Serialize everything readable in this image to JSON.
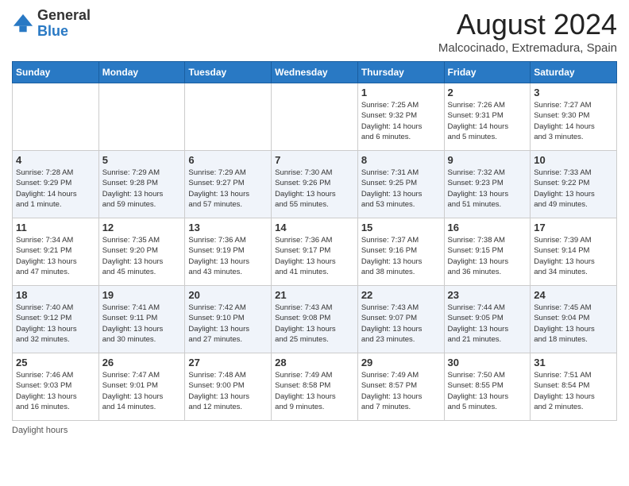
{
  "header": {
    "logo_general": "General",
    "logo_blue": "Blue",
    "month_title": "August 2024",
    "location": "Malcocinado, Extremadura, Spain"
  },
  "days_of_week": [
    "Sunday",
    "Monday",
    "Tuesday",
    "Wednesday",
    "Thursday",
    "Friday",
    "Saturday"
  ],
  "footer": {
    "daylight_note": "Daylight hours"
  },
  "weeks": [
    [
      {
        "day": "",
        "info": ""
      },
      {
        "day": "",
        "info": ""
      },
      {
        "day": "",
        "info": ""
      },
      {
        "day": "",
        "info": ""
      },
      {
        "day": "1",
        "info": "Sunrise: 7:25 AM\nSunset: 9:32 PM\nDaylight: 14 hours\nand 6 minutes."
      },
      {
        "day": "2",
        "info": "Sunrise: 7:26 AM\nSunset: 9:31 PM\nDaylight: 14 hours\nand 5 minutes."
      },
      {
        "day": "3",
        "info": "Sunrise: 7:27 AM\nSunset: 9:30 PM\nDaylight: 14 hours\nand 3 minutes."
      }
    ],
    [
      {
        "day": "4",
        "info": "Sunrise: 7:28 AM\nSunset: 9:29 PM\nDaylight: 14 hours\nand 1 minute."
      },
      {
        "day": "5",
        "info": "Sunrise: 7:29 AM\nSunset: 9:28 PM\nDaylight: 13 hours\nand 59 minutes."
      },
      {
        "day": "6",
        "info": "Sunrise: 7:29 AM\nSunset: 9:27 PM\nDaylight: 13 hours\nand 57 minutes."
      },
      {
        "day": "7",
        "info": "Sunrise: 7:30 AM\nSunset: 9:26 PM\nDaylight: 13 hours\nand 55 minutes."
      },
      {
        "day": "8",
        "info": "Sunrise: 7:31 AM\nSunset: 9:25 PM\nDaylight: 13 hours\nand 53 minutes."
      },
      {
        "day": "9",
        "info": "Sunrise: 7:32 AM\nSunset: 9:23 PM\nDaylight: 13 hours\nand 51 minutes."
      },
      {
        "day": "10",
        "info": "Sunrise: 7:33 AM\nSunset: 9:22 PM\nDaylight: 13 hours\nand 49 minutes."
      }
    ],
    [
      {
        "day": "11",
        "info": "Sunrise: 7:34 AM\nSunset: 9:21 PM\nDaylight: 13 hours\nand 47 minutes."
      },
      {
        "day": "12",
        "info": "Sunrise: 7:35 AM\nSunset: 9:20 PM\nDaylight: 13 hours\nand 45 minutes."
      },
      {
        "day": "13",
        "info": "Sunrise: 7:36 AM\nSunset: 9:19 PM\nDaylight: 13 hours\nand 43 minutes."
      },
      {
        "day": "14",
        "info": "Sunrise: 7:36 AM\nSunset: 9:17 PM\nDaylight: 13 hours\nand 41 minutes."
      },
      {
        "day": "15",
        "info": "Sunrise: 7:37 AM\nSunset: 9:16 PM\nDaylight: 13 hours\nand 38 minutes."
      },
      {
        "day": "16",
        "info": "Sunrise: 7:38 AM\nSunset: 9:15 PM\nDaylight: 13 hours\nand 36 minutes."
      },
      {
        "day": "17",
        "info": "Sunrise: 7:39 AM\nSunset: 9:14 PM\nDaylight: 13 hours\nand 34 minutes."
      }
    ],
    [
      {
        "day": "18",
        "info": "Sunrise: 7:40 AM\nSunset: 9:12 PM\nDaylight: 13 hours\nand 32 minutes."
      },
      {
        "day": "19",
        "info": "Sunrise: 7:41 AM\nSunset: 9:11 PM\nDaylight: 13 hours\nand 30 minutes."
      },
      {
        "day": "20",
        "info": "Sunrise: 7:42 AM\nSunset: 9:10 PM\nDaylight: 13 hours\nand 27 minutes."
      },
      {
        "day": "21",
        "info": "Sunrise: 7:43 AM\nSunset: 9:08 PM\nDaylight: 13 hours\nand 25 minutes."
      },
      {
        "day": "22",
        "info": "Sunrise: 7:43 AM\nSunset: 9:07 PM\nDaylight: 13 hours\nand 23 minutes."
      },
      {
        "day": "23",
        "info": "Sunrise: 7:44 AM\nSunset: 9:05 PM\nDaylight: 13 hours\nand 21 minutes."
      },
      {
        "day": "24",
        "info": "Sunrise: 7:45 AM\nSunset: 9:04 PM\nDaylight: 13 hours\nand 18 minutes."
      }
    ],
    [
      {
        "day": "25",
        "info": "Sunrise: 7:46 AM\nSunset: 9:03 PM\nDaylight: 13 hours\nand 16 minutes."
      },
      {
        "day": "26",
        "info": "Sunrise: 7:47 AM\nSunset: 9:01 PM\nDaylight: 13 hours\nand 14 minutes."
      },
      {
        "day": "27",
        "info": "Sunrise: 7:48 AM\nSunset: 9:00 PM\nDaylight: 13 hours\nand 12 minutes."
      },
      {
        "day": "28",
        "info": "Sunrise: 7:49 AM\nSunset: 8:58 PM\nDaylight: 13 hours\nand 9 minutes."
      },
      {
        "day": "29",
        "info": "Sunrise: 7:49 AM\nSunset: 8:57 PM\nDaylight: 13 hours\nand 7 minutes."
      },
      {
        "day": "30",
        "info": "Sunrise: 7:50 AM\nSunset: 8:55 PM\nDaylight: 13 hours\nand 5 minutes."
      },
      {
        "day": "31",
        "info": "Sunrise: 7:51 AM\nSunset: 8:54 PM\nDaylight: 13 hours\nand 2 minutes."
      }
    ]
  ]
}
